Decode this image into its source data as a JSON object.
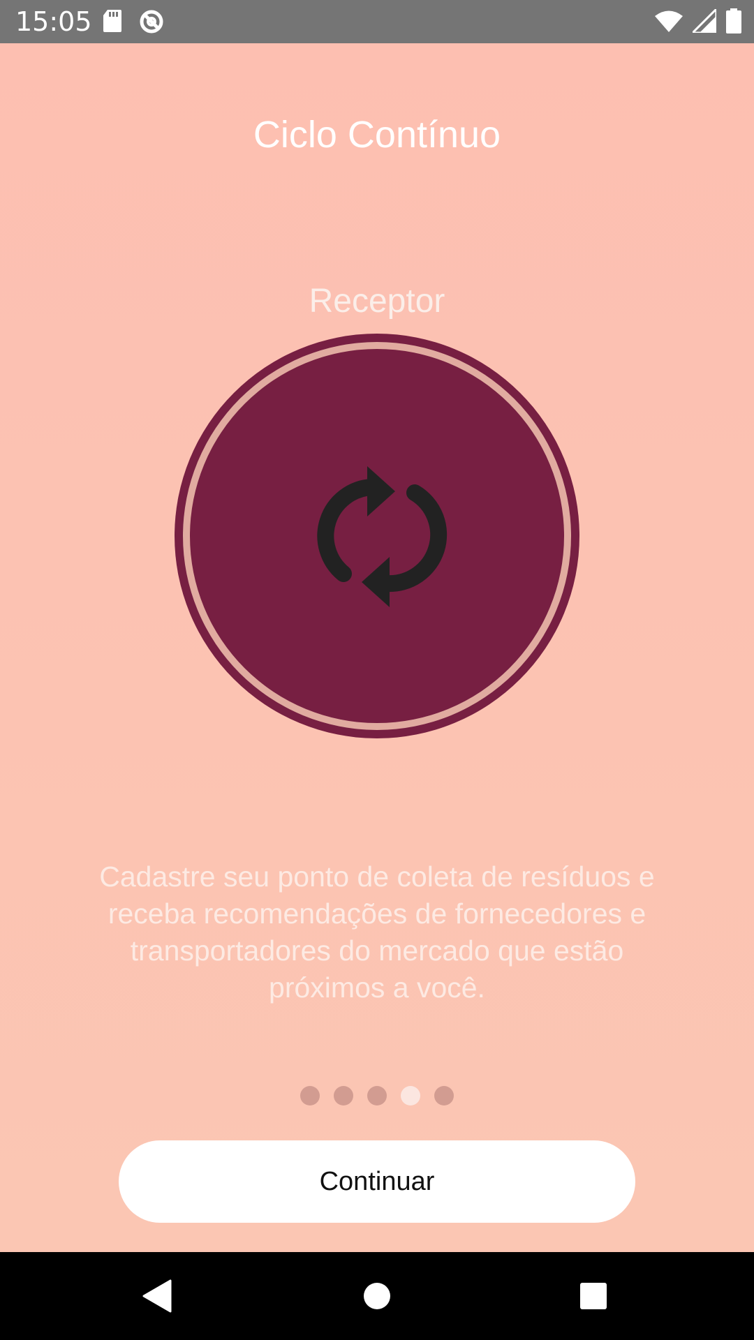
{
  "status_bar": {
    "time": "15:05",
    "icons": [
      "sd-card-icon",
      "no-sync-icon",
      "wifi-icon",
      "signal-icon",
      "battery-icon"
    ]
  },
  "onboarding": {
    "title": "Ciclo Contínuo",
    "subtitle": "Receptor",
    "icon": "sync-icon",
    "description": "Cadastre seu ponto de coleta de resíduos e receba recomendações de fornecedores e transportadores do mercado que estão próximos a você.",
    "pager": {
      "total_pages": 5,
      "current_page": 4
    },
    "continue_label": "Continuar"
  },
  "colors": {
    "background": "#fcc2b2",
    "circle": "#771f42",
    "ring": "#e1aba0",
    "dot_inactive": "#d29c91",
    "dot_active": "#fbe6e0"
  },
  "nav_bar": {
    "buttons": [
      "back-icon",
      "home-icon",
      "recents-icon"
    ]
  }
}
